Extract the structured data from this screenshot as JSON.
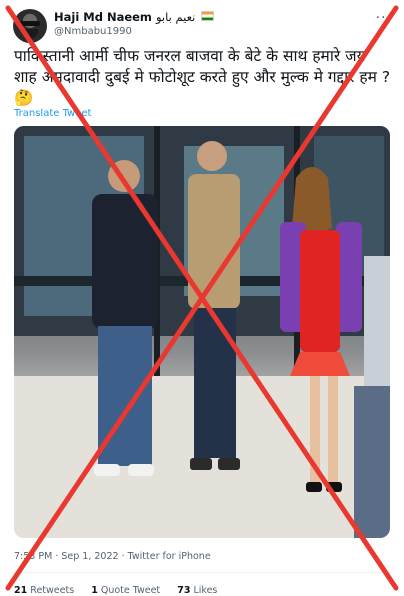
{
  "author": {
    "name": "Haji Md Naeem",
    "name_native": "نعیم بابو",
    "handle": "@Nmbabu1990",
    "flag_icon": "india-flag-icon"
  },
  "tweet": {
    "text": "पाकिस्तानी आर्मी चीफ जनरल बाजवा के बेटे के साथ हमारे जय शाह अमदावादी दुबई मे फोटोशूट करते हुए और मुल्क मे गद्दार हम ?🤔",
    "translate_label": "Translate Tweet"
  },
  "meta": {
    "time": "7:53 PM",
    "separator": "·",
    "date": "Sep 1, 2022",
    "source": "Twitter for iPhone"
  },
  "stats": {
    "retweets_count": "21",
    "retweets_label": "Retweets",
    "quotes_count": "1",
    "quotes_label": "Quote Tweet",
    "likes_count": "73",
    "likes_label": "Likes"
  },
  "overlay": {
    "cross_color": "#e8382f"
  }
}
